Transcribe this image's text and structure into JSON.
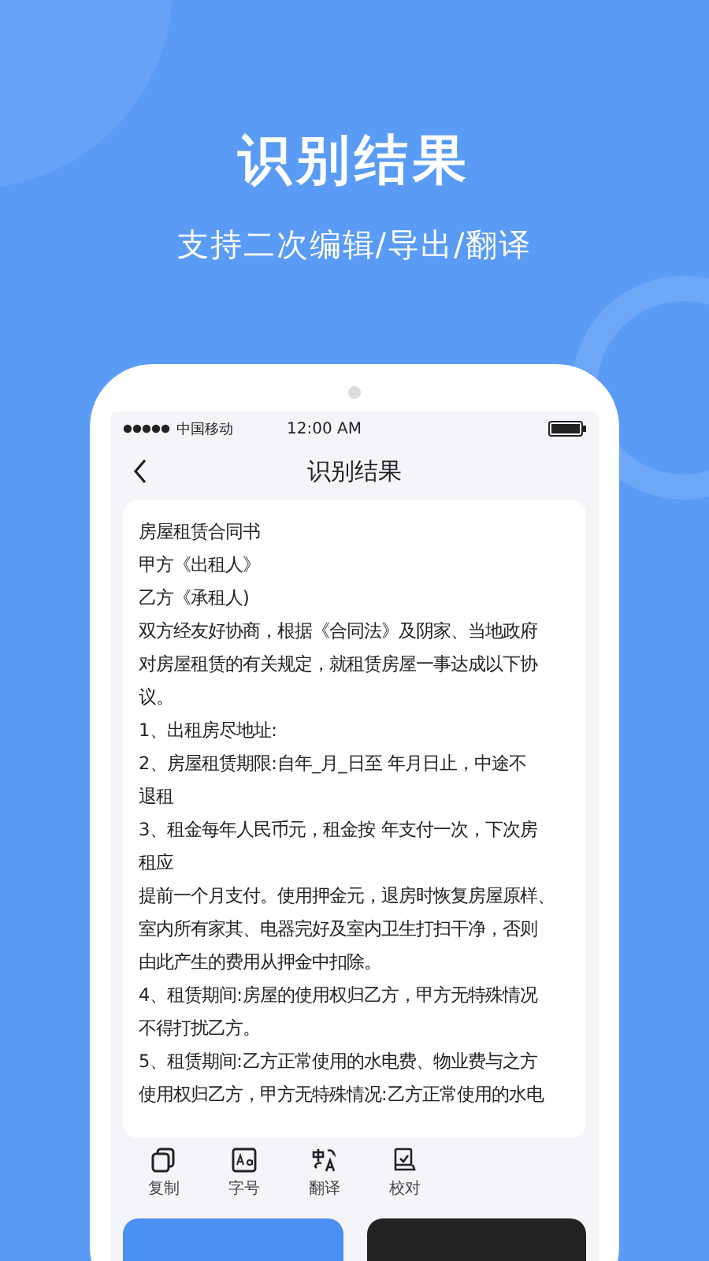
{
  "promo": {
    "title": "识别结果",
    "subtitle": "支持二次编辑/导出/翻译"
  },
  "status_bar": {
    "carrier": "中国移动",
    "time": "12:00 AM"
  },
  "nav": {
    "title": "识别结果"
  },
  "document_lines": [
    "房屋租赁合同书",
    "甲方《出租人》",
    "乙方《承租人)",
    "双方经友好协商，根据《合同法》及阴家、当地政府",
    "对房屋租赁的有关规定，就租赁房屋一事达成以下协",
    "议。",
    "1、出租房尽地址:",
    "2、房屋租赁期限:自年_月_日至  年月日止，中途不",
    "退租",
    "3、租金每年人民币元，租金按 年支付一次，下次房",
    "租应",
    "提前一个月支付。使用押金元，退房时恢复房屋原样、",
    "室内所有家其、电器完好及室内卫生打扫干净，否则",
    "由此产生的费用从押金中扣除。",
    "4、租赁期间:房屋的使用权归乙方，甲方无特殊情况",
    "不得打扰乙方。",
    "5、租赁期间:乙方正常使用的水电费、物业费与之方",
    "使用权归乙方，甲方无特殊情况:乙方正常使用的水电"
  ],
  "tools": [
    {
      "kind": "copy",
      "label": "复制"
    },
    {
      "kind": "font",
      "label": "字号"
    },
    {
      "kind": "translate",
      "label": "翻译"
    },
    {
      "kind": "proofread",
      "label": "校对"
    }
  ],
  "buttons": [
    {
      "kind": "primary"
    },
    {
      "kind": "dark"
    }
  ]
}
